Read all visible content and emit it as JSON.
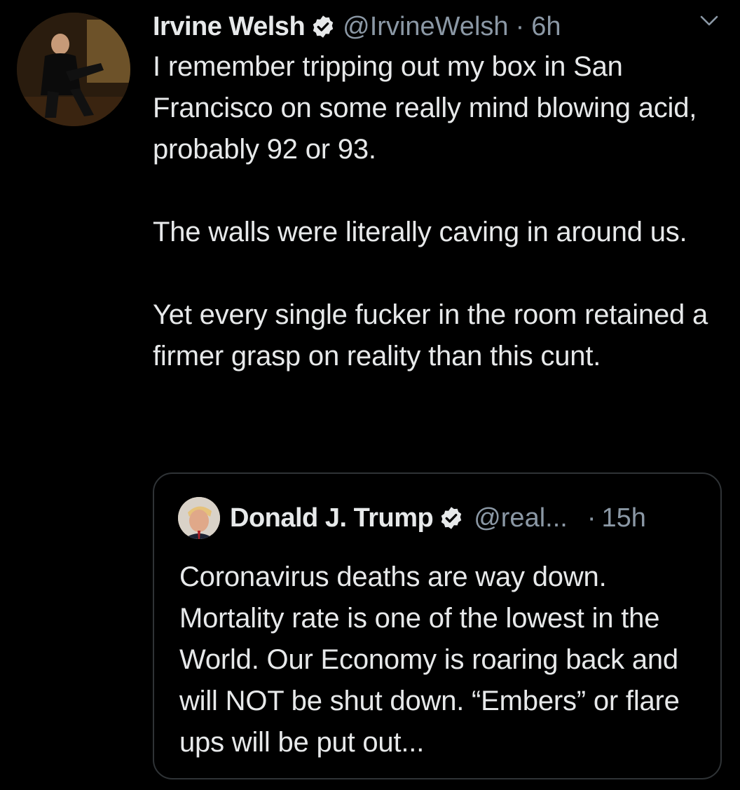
{
  "colors": {
    "background": "#000000",
    "text": "#e7e9ea",
    "secondary_text": "#8b98a5",
    "border": "#2f3336",
    "verified_badge": "#e7e9ea"
  },
  "tweet": {
    "author_name": "Irvine Welsh",
    "handle": "@IrvineWelsh",
    "separator": "·",
    "time": "6h",
    "verified_icon": "verified-badge-icon",
    "more_icon": "chevron-down-icon",
    "paragraphs": [
      "I remember tripping out my box in San Francisco on some really mind blowing acid, probably 92 or 93.",
      "The walls were literally caving in around us.",
      "Yet every single fucker in the room retained a firmer grasp on reality than this cunt."
    ]
  },
  "quoted_tweet": {
    "author_name": "Donald J. Trump",
    "handle": "@real...",
    "separator": "·",
    "time": "15h",
    "verified_icon": "verified-badge-icon",
    "text": "Coronavirus deaths are way down. Mortality rate is one of the lowest in the World. Our Economy is roaring back and will NOT be shut down. “Embers” or flare ups will be put out..."
  }
}
